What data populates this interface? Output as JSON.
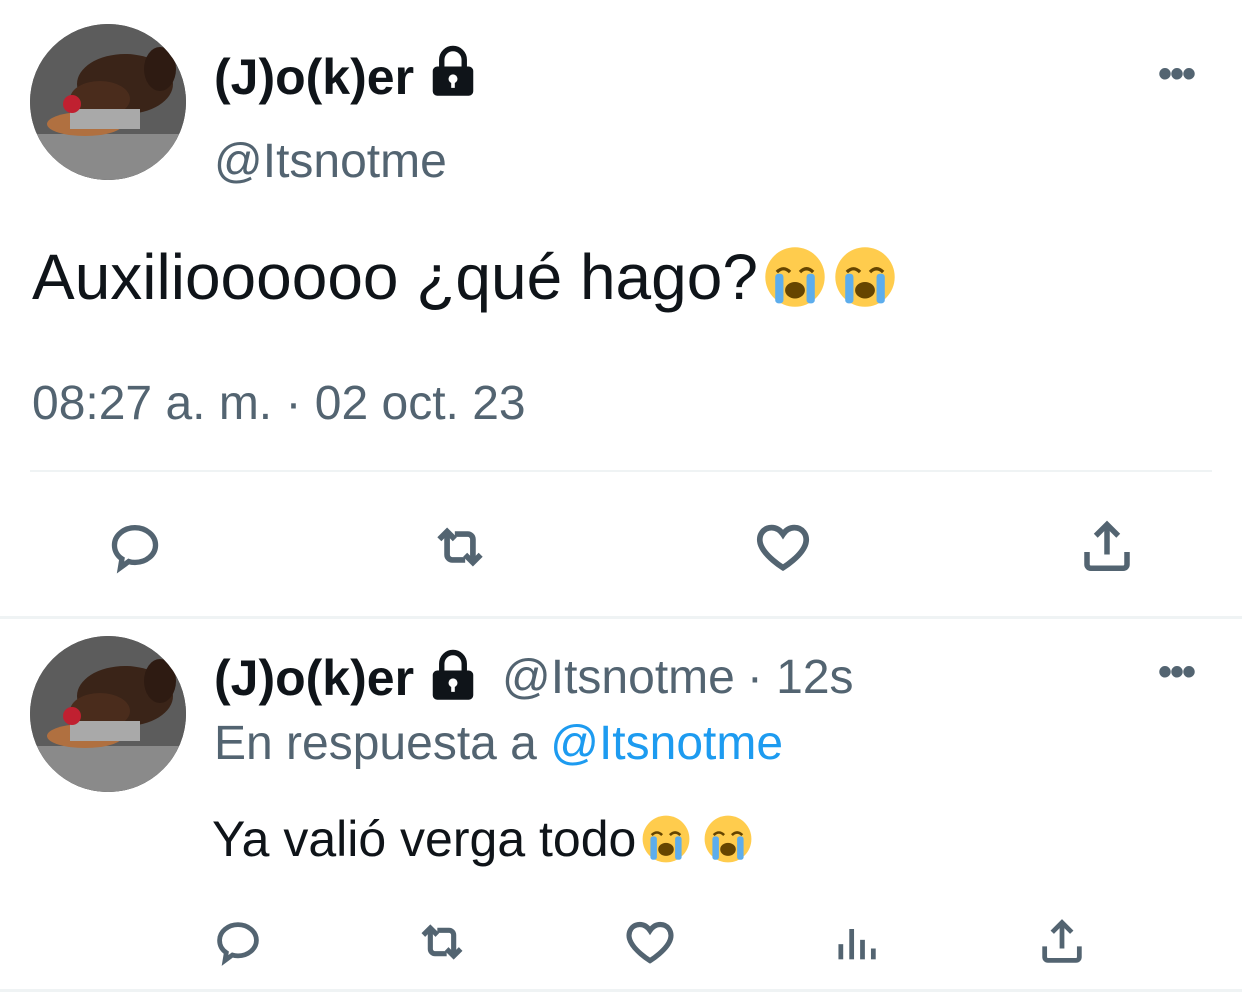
{
  "main_tweet": {
    "display_name": "(J)o(k)er",
    "handle": "@Itsnotme",
    "text": "Auxilioooooo ¿qué hago?",
    "emojis": [
      "loudly-crying-face",
      "loudly-crying-face"
    ],
    "timestamp": "08:27 a. m. · 02 oct. 23",
    "more_label": "•••"
  },
  "reply_tweet": {
    "display_name": "(J)o(k)er",
    "handle": "@Itsnotme",
    "time_ago": "· 12s",
    "replying_to_prefix": "En respuesta a",
    "replying_to_handle": "@Itsnotme",
    "text": "Ya valió verga todo",
    "emojis": [
      "loudly-crying-face",
      "loudly-crying-face"
    ],
    "more_label": "•••"
  },
  "icons": {
    "lock": "lock-icon",
    "reply": "reply-icon",
    "retweet": "retweet-icon",
    "like": "like-icon",
    "share": "share-icon",
    "analytics": "analytics-icon"
  },
  "colors": {
    "text_primary": "#0f1419",
    "text_secondary": "#536471",
    "link": "#1d9bf0",
    "divider": "#eff3f4"
  }
}
